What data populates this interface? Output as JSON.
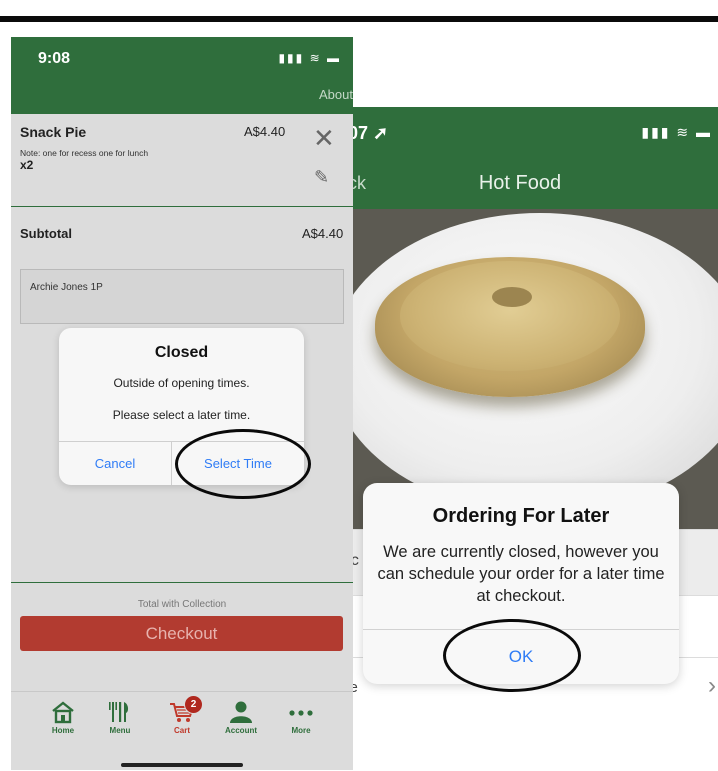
{
  "right_screen": {
    "status_time": "07",
    "status_icons": "▮▮▮ ≋ ▬",
    "back_label": "ck",
    "title": "Hot Food",
    "row1_partial": "ac",
    "row3_partial": "ce",
    "chevron": "›",
    "alert": {
      "title": "Ordering For Later",
      "message": "We are currently closed, however you can schedule your order for a later time at checkout.",
      "ok_label": "OK"
    }
  },
  "left_screen": {
    "status_time": "9:08",
    "status_icons": "▮▮▮ ≋ ▬",
    "nav_about": "About",
    "item": {
      "name": "Snack Pie",
      "price": "A$4.40",
      "note": "Note: one for recess one for lunch",
      "qty": "x2"
    },
    "subtotal_label": "Subtotal",
    "subtotal_value": "A$4.40",
    "order_name": "Archie Jones 1P",
    "total_label": "Total with Collection",
    "checkout_label": "Checkout",
    "tabs": [
      {
        "label": "Home"
      },
      {
        "label": "Menu"
      },
      {
        "label": "Cart",
        "badge": "2"
      },
      {
        "label": "Account"
      },
      {
        "label": "More"
      }
    ],
    "alert": {
      "title": "Closed",
      "message1": "Outside of opening times.",
      "message2": "Please select a later time.",
      "cancel_label": "Cancel",
      "select_label": "Select Time"
    }
  },
  "colors": {
    "brand_green": "#2f6e3c",
    "checkout_red": "#b23b30",
    "ios_blue": "#2f7cf6"
  }
}
